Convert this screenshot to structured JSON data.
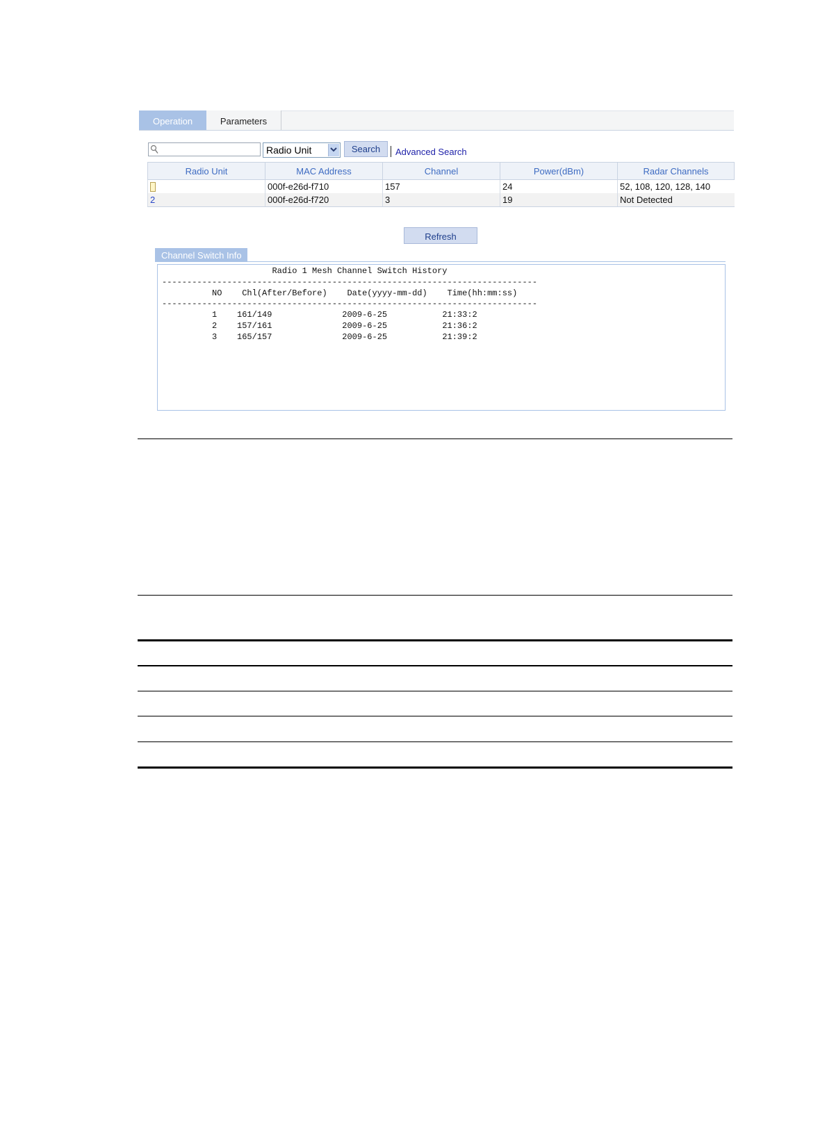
{
  "tabs": [
    {
      "label": "Operation",
      "active": true
    },
    {
      "label": "Parameters",
      "active": false
    }
  ],
  "search": {
    "placeholder": "",
    "field_selected": "Radio Unit",
    "search_button": "Search",
    "advanced_link": "Advanced Search"
  },
  "table": {
    "columns": [
      "Radio Unit",
      "MAC Address",
      "Channel",
      "Power(dBm)",
      "Radar Channels"
    ],
    "rows": [
      {
        "radio_unit": "",
        "mac": "000f-e26d-f710",
        "channel": "157",
        "power": "24",
        "radar": "52, 108, 120, 128, 140"
      },
      {
        "radio_unit": "2",
        "mac": "000f-e26d-f720",
        "channel": "3",
        "power": "19",
        "radar": "Not Detected"
      }
    ]
  },
  "refresh_button": "Refresh",
  "panel": {
    "tab_label": "Channel Switch Info",
    "title": "Radio 1 Mesh Channel Switch History",
    "separator": "---------------------------------------------------------------------------",
    "headers": {
      "no": "NO",
      "chl": "Chl(After/Before)",
      "date": "Date(yyyy-mm-dd)",
      "time": "Time(hh:mm:ss)"
    },
    "records": [
      {
        "no": "1",
        "chl": "161/149",
        "date": "2009-6-25",
        "time": "21:33:2"
      },
      {
        "no": "2",
        "chl": "157/161",
        "date": "2009-6-25",
        "time": "21:36:2"
      },
      {
        "no": "3",
        "chl": "165/157",
        "date": "2009-6-25",
        "time": "21:39:2"
      }
    ]
  },
  "colors": {
    "accent": "#a9c2e6",
    "header_text": "#3d6bc2",
    "link": "#1c1fa8"
  }
}
